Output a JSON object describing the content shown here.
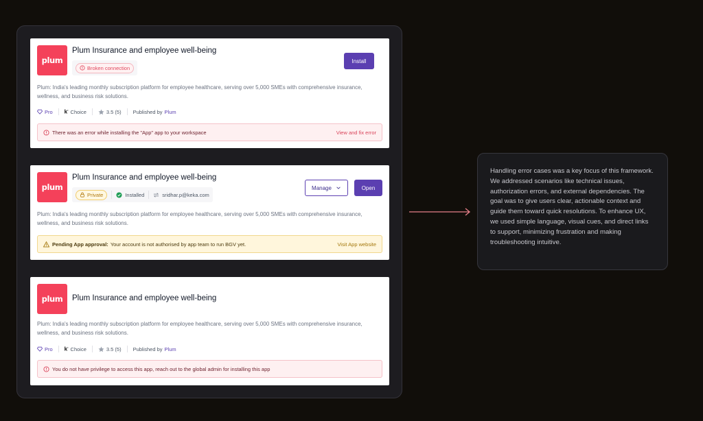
{
  "cards": [
    {
      "logo_text": "plum",
      "title": "Plum Insurance and employee well-being",
      "status_badge": "Broken connection",
      "action_button": "Install",
      "description": "Plum: India's leading monthly subscription platform for employee healthcare, serving over 5,000 SMEs with comprehensive insurance, wellness, and business risk solutions.",
      "meta": {
        "pro": "Pro",
        "choice": "Choice",
        "rating": "3.5 (5)",
        "published_by": "Published by",
        "publisher": "Plum"
      },
      "alert": {
        "type": "error",
        "message": "There was an error while installing the \"App\" app to your workspace",
        "link": "View and fix error"
      }
    },
    {
      "logo_text": "plum",
      "title": "Plum Insurance and employee well-being",
      "status_badge": "Private",
      "installed": "Installed",
      "installed_by": "sridhar.p@keka.com",
      "manage_button": "Manage",
      "open_button": "Open",
      "description": "Plum: India's leading monthly subscription platform for employee healthcare, serving over 5,000 SMEs with comprehensive insurance, wellness, and business risk solutions.",
      "alert": {
        "type": "warning",
        "title": "Pending App approval:",
        "message": "Your account is not authorised by app team to run BGV yet.",
        "link": "Visit App website"
      }
    },
    {
      "logo_text": "plum",
      "title": "Plum Insurance and employee well-being",
      "description": "Plum: India's leading monthly subscription platform for employee healthcare, serving over 5,000 SMEs with comprehensive insurance, wellness, and business risk solutions.",
      "meta": {
        "pro": "Pro",
        "choice": "Choice",
        "rating": "3.5 (5)",
        "published_by": "Published by",
        "publisher": "Plum"
      },
      "alert": {
        "type": "error",
        "message": "You do not have privilege to access this app, reach out to the global admin for installing this app"
      }
    }
  ],
  "note": {
    "text": "Handling error cases was a key focus of this framework. We addressed scenarios like technical issues, authorization errors, and external dependencies. The goal was to give users clear, actionable context and guide them toward quick resolutions. To enhance UX, we used simple language, visual cues, and direct links to support, minimizing frustration and making troubleshooting intuitive."
  },
  "colors": {
    "background": "#110e0a",
    "brand_logo": "#f4415a",
    "primary_button": "#5b3fb1",
    "error": "#d9445a",
    "warning": "#a4780d",
    "arrow": "#e8808a"
  }
}
